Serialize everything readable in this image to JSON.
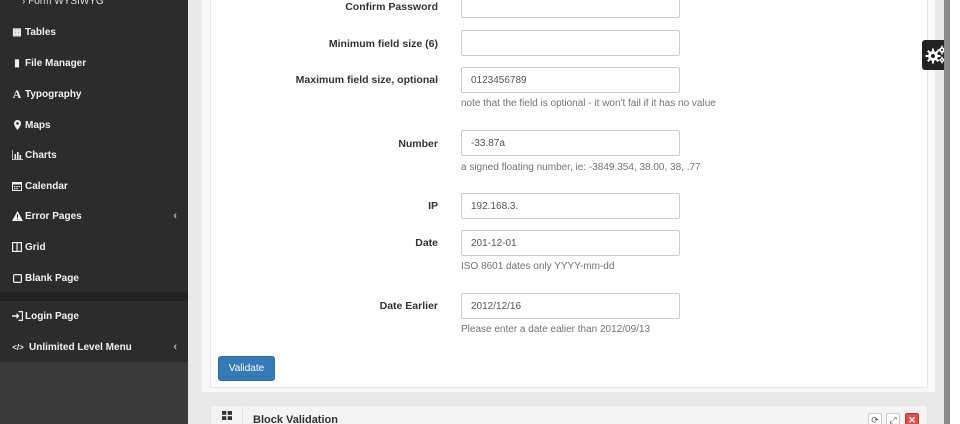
{
  "sidebar": {
    "sub_item": "› Form WYSIWYG",
    "items": [
      {
        "label": "Tables",
        "icon": "table-icon",
        "glyph": "▦"
      },
      {
        "label": "File Manager",
        "icon": "file-icon",
        "glyph": "▮"
      },
      {
        "label": "Typography",
        "icon": "typography-icon",
        "glyph": "A"
      },
      {
        "label": "Maps",
        "icon": "map-marker-icon",
        "glyph": "⚲"
      },
      {
        "label": "Charts",
        "icon": "bar-chart-icon",
        "glyph": "▥"
      },
      {
        "label": "Calendar",
        "icon": "calendar-icon",
        "glyph": "▤"
      },
      {
        "label": "Error Pages",
        "icon": "warning-icon",
        "glyph": "▲",
        "caret": "‹"
      },
      {
        "label": "Grid",
        "icon": "grid-icon",
        "glyph": "◫"
      },
      {
        "label": "Blank Page",
        "icon": "blank-page-icon",
        "glyph": "▢"
      },
      {
        "label": "Login Page",
        "icon": "sign-in-icon",
        "glyph": "➜"
      },
      {
        "label": "Unlimited Level Menu",
        "icon": "code-icon",
        "glyph": "</>",
        "caret": "‹"
      }
    ]
  },
  "form": {
    "fields": [
      {
        "label": "Confirm Password",
        "value": "",
        "help": ""
      },
      {
        "label": "Minimum field size (6)",
        "value": "",
        "help": ""
      },
      {
        "label": "Maximum field size, optional",
        "value": "0123456789",
        "help": "note that the field is optional - it won't fail if it has no value"
      },
      {
        "label": "Number",
        "value": "-33.87a",
        "help": "a signed floating number, ie: -3849.354, 38.00, 38, .77"
      },
      {
        "label": "IP",
        "value": "192.168.3.",
        "help": ""
      },
      {
        "label": "Date",
        "value": "201-12-01",
        "help": "ISO 8601 dates only YYYY-mm-dd"
      },
      {
        "label": "Date Earlier",
        "value": "2012/12/16",
        "help": "Please enter a date ealier than 2012/09/13"
      }
    ],
    "validate_label": "Validate"
  },
  "block": {
    "title": "Block Validation",
    "icon": "th-large-icon",
    "tools": [
      "refresh-icon",
      "expand-icon",
      "close-icon"
    ]
  },
  "widget": {
    "icon": "gears-icon"
  },
  "colors": {
    "sidebar_bg": "#2c2c2c",
    "primary": "#337ab7",
    "danger": "#d9534f"
  }
}
